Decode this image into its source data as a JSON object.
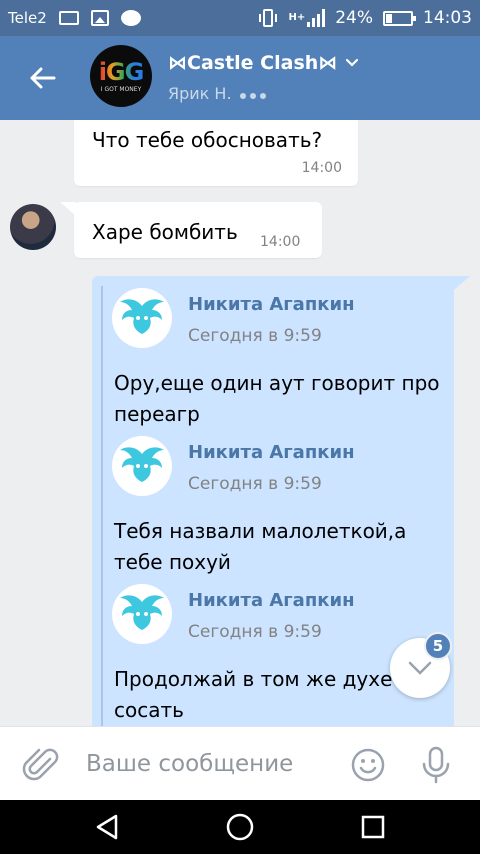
{
  "status_bar": {
    "carrier": "Tele2",
    "network": "H+",
    "battery": "24%",
    "time": "14:03"
  },
  "header": {
    "title": "⋈Castle Clash⋈",
    "subtitle": "Ярик Н.",
    "avatar_text": "iGG",
    "avatar_sub": "I GOT MONEY"
  },
  "messages": [
    {
      "text": "Что тебе обосновать?",
      "time": "14:00"
    },
    {
      "text": "Харе бомбить",
      "time": "14:00"
    }
  ],
  "forwarded": [
    {
      "name": "Никита Агапкин",
      "date": "Сегодня в 9:59",
      "text": "Ору,еще один аут говорит про переагр"
    },
    {
      "name": "Никита Агапкин",
      "date": "Сегодня в 9:59",
      "text": "Тебя назвали малолеткой,а тебе похуй"
    },
    {
      "name": "Никита Агапкин",
      "date": "Сегодня в 9:59",
      "text": "Продолжай в том же духе хуи сосать"
    }
  ],
  "unread_badge": "5",
  "input": {
    "placeholder": "Ваше сообщение"
  },
  "colors": {
    "header": "#5181b8",
    "status": "#4b6e9b",
    "outgoing": "#cce4ff",
    "link": "#4a76a8"
  }
}
